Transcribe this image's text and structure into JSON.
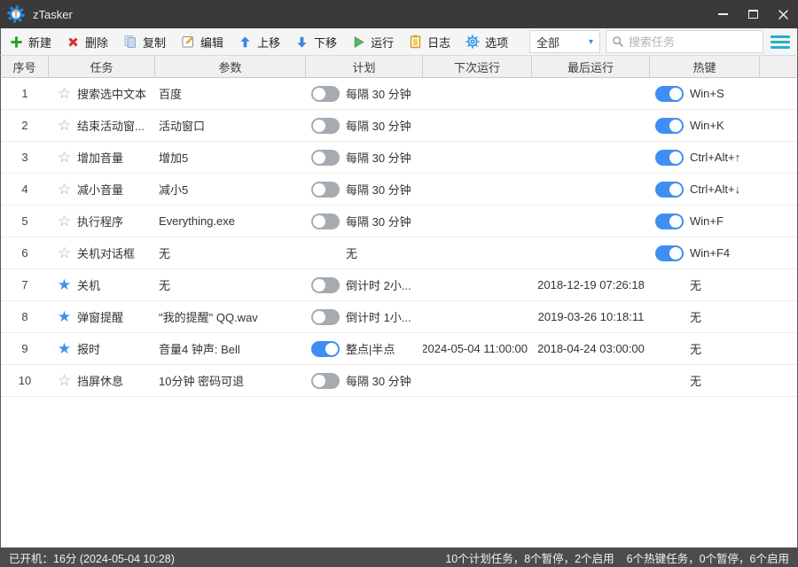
{
  "window": {
    "title": "zTasker"
  },
  "toolbar": {
    "buttons": [
      {
        "label": "新建",
        "icon": "plus-icon"
      },
      {
        "label": "删除",
        "icon": "delete-icon"
      },
      {
        "label": "复制",
        "icon": "copy-icon"
      },
      {
        "label": "编辑",
        "icon": "edit-icon"
      },
      {
        "label": "上移",
        "icon": "move-up-icon"
      },
      {
        "label": "下移",
        "icon": "move-down-icon"
      },
      {
        "label": "运行",
        "icon": "run-icon"
      },
      {
        "label": "日志",
        "icon": "log-icon"
      },
      {
        "label": "选项",
        "icon": "options-icon"
      }
    ],
    "filter": {
      "value": "全部"
    },
    "search": {
      "placeholder": "搜索任务"
    }
  },
  "table": {
    "columns": [
      "序号",
      "任务",
      "参数",
      "计划",
      "下次运行",
      "最后运行",
      "热键"
    ],
    "rows": [
      {
        "no": "1",
        "starred": false,
        "task": "搜索选中文本",
        "params": "百度",
        "schedule": {
          "toggle": "off",
          "text": "每隔 30 分钟"
        },
        "next_run": "",
        "last_run": "",
        "hotkey": {
          "toggle": "on",
          "text": "Win+S"
        }
      },
      {
        "no": "2",
        "starred": false,
        "task": "结束活动窗...",
        "params": "活动窗口",
        "schedule": {
          "toggle": "off",
          "text": "每隔 30 分钟"
        },
        "next_run": "",
        "last_run": "",
        "hotkey": {
          "toggle": "on",
          "text": "Win+K"
        }
      },
      {
        "no": "3",
        "starred": false,
        "task": "增加音量",
        "params": "增加5",
        "schedule": {
          "toggle": "off",
          "text": "每隔 30 分钟"
        },
        "next_run": "",
        "last_run": "",
        "hotkey": {
          "toggle": "on",
          "text": "Ctrl+Alt+↑"
        }
      },
      {
        "no": "4",
        "starred": false,
        "task": "减小音量",
        "params": "减小5",
        "schedule": {
          "toggle": "off",
          "text": "每隔 30 分钟"
        },
        "next_run": "",
        "last_run": "",
        "hotkey": {
          "toggle": "on",
          "text": "Ctrl+Alt+↓"
        }
      },
      {
        "no": "5",
        "starred": false,
        "task": "执行程序",
        "params": "Everything.exe",
        "schedule": {
          "toggle": "off",
          "text": "每隔 30 分钟"
        },
        "next_run": "",
        "last_run": "",
        "hotkey": {
          "toggle": "on",
          "text": "Win+F"
        }
      },
      {
        "no": "6",
        "starred": false,
        "task": "关机对话框",
        "params": "无",
        "schedule": {
          "toggle": "none",
          "text": "无"
        },
        "next_run": "",
        "last_run": "",
        "hotkey": {
          "toggle": "on",
          "text": "Win+F4"
        }
      },
      {
        "no": "7",
        "starred": true,
        "task": "关机",
        "params": "无",
        "schedule": {
          "toggle": "off",
          "text": "倒计时 2小..."
        },
        "next_run": "",
        "last_run": "2018-12-19 07:26:18",
        "hotkey": {
          "toggle": "none",
          "text": "无"
        }
      },
      {
        "no": "8",
        "starred": true,
        "task": "弹窗提醒",
        "params": "\"我的提醒\" QQ.wav",
        "schedule": {
          "toggle": "off",
          "text": "倒计时 1小..."
        },
        "next_run": "",
        "last_run": "2019-03-26 10:18:11",
        "hotkey": {
          "toggle": "none",
          "text": "无"
        }
      },
      {
        "no": "9",
        "starred": true,
        "task": "报时",
        "params": "音量4 钟声: Bell",
        "schedule": {
          "toggle": "on",
          "text": "整点|半点"
        },
        "next_run": "2024-05-04 11:00:00",
        "last_run": "2018-04-24 03:00:00",
        "hotkey": {
          "toggle": "none",
          "text": "无"
        }
      },
      {
        "no": "10",
        "starred": false,
        "task": "挡屏休息",
        "params": "10分钟 密码可退",
        "schedule": {
          "toggle": "off",
          "text": "每隔 30 分钟"
        },
        "next_run": "",
        "last_run": "",
        "hotkey": {
          "toggle": "none",
          "text": "无"
        }
      }
    ]
  },
  "statusbar": {
    "uptime": "已开机：16分 (2024-05-04 10:28)",
    "plan_stats": "10个计划任务，8个暂停，2个启用",
    "hotkey_stats": "6个热键任务，0个暂停，6个启用"
  },
  "colors": {
    "accent_blue": "#3f8ef3",
    "toggle_off": "#a6abb1",
    "teal": "#25b0c6",
    "green": "#28a428",
    "red": "#d2342c"
  }
}
